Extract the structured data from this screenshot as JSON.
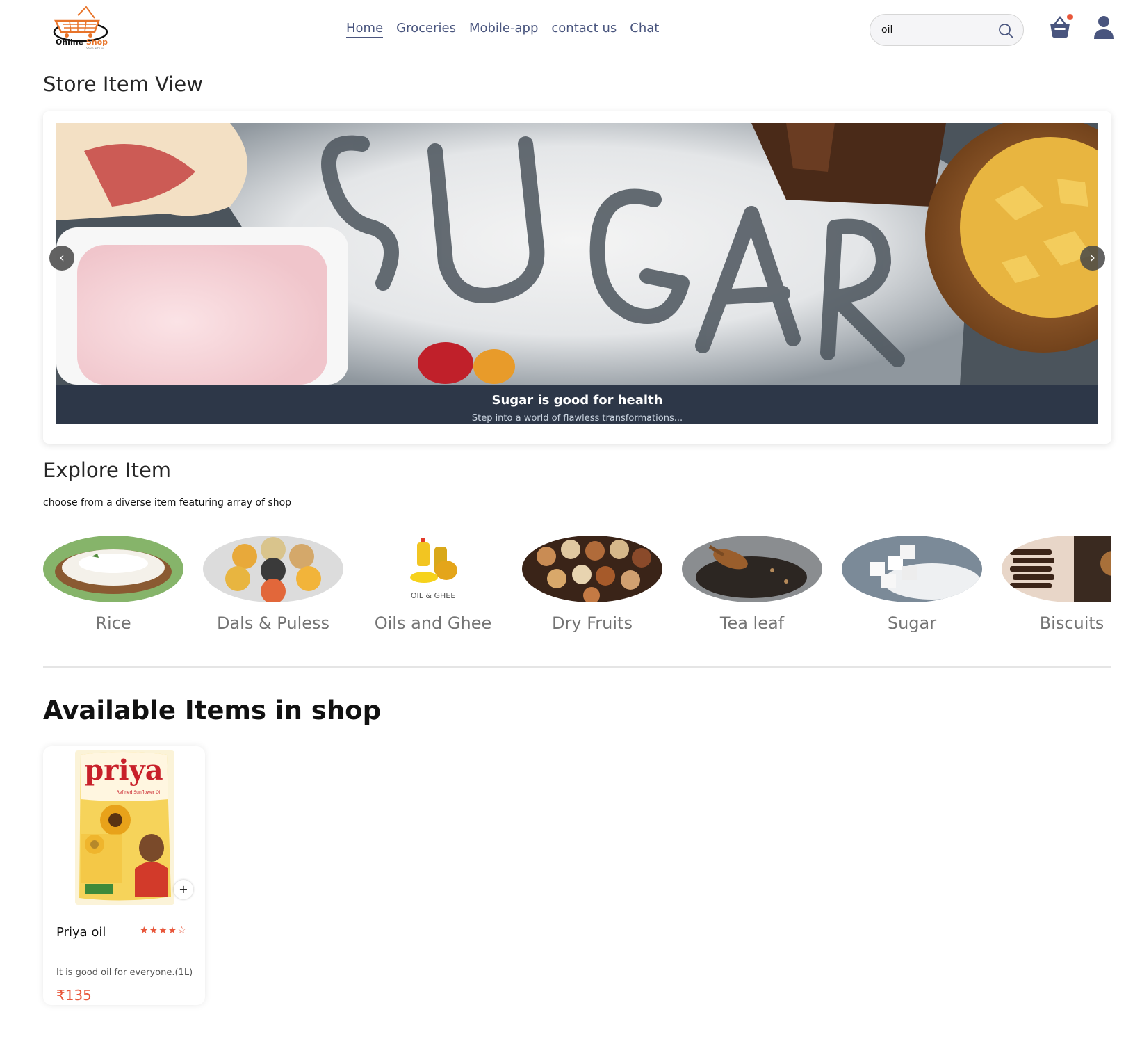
{
  "brand": {
    "logo_word1": "Online",
    "logo_word2": "Shop",
    "logo_tagline": "Store with us"
  },
  "nav": {
    "items": [
      {
        "label": "Home",
        "active": true
      },
      {
        "label": "Groceries"
      },
      {
        "label": "Mobile-app"
      },
      {
        "label": "contact us"
      },
      {
        "label": "Chat"
      }
    ]
  },
  "search": {
    "value": "oil",
    "icon": "search-icon"
  },
  "header_icons": {
    "basket": "basket-icon",
    "user": "user-icon",
    "notification_color": "#e8563a"
  },
  "store_view": {
    "title": "Store Item View",
    "slide": {
      "heading": "Sugar is good for health",
      "subtext": "Step into a world of flawless transformations..."
    },
    "prev_label": "‹",
    "next_label": "›"
  },
  "explore": {
    "title": "Explore Item",
    "subtitle": "choose from a diverse item featuring array of shop",
    "categories": [
      {
        "label": "Rice"
      },
      {
        "label": "Dals & Puless"
      },
      {
        "label": "Oils and Ghee",
        "image_caption": "OIL & GHEE"
      },
      {
        "label": "Dry Fruits"
      },
      {
        "label": "Tea leaf"
      },
      {
        "label": "Sugar"
      },
      {
        "label": "Biscuits"
      }
    ]
  },
  "available": {
    "title": "Available Items in shop",
    "products": [
      {
        "name": "Priya oil",
        "rating_stars": "★★★★☆",
        "rating": 4,
        "description": "It is good oil for everyone.(1L)",
        "price": "₹135",
        "pack_brand": "priya",
        "pack_sub": "Refined Sunflower Oil",
        "add_label": "+"
      }
    ]
  },
  "colors": {
    "accent": "#e8563a",
    "nav_text": "#49557e",
    "caption_bg": "#2d3748"
  }
}
